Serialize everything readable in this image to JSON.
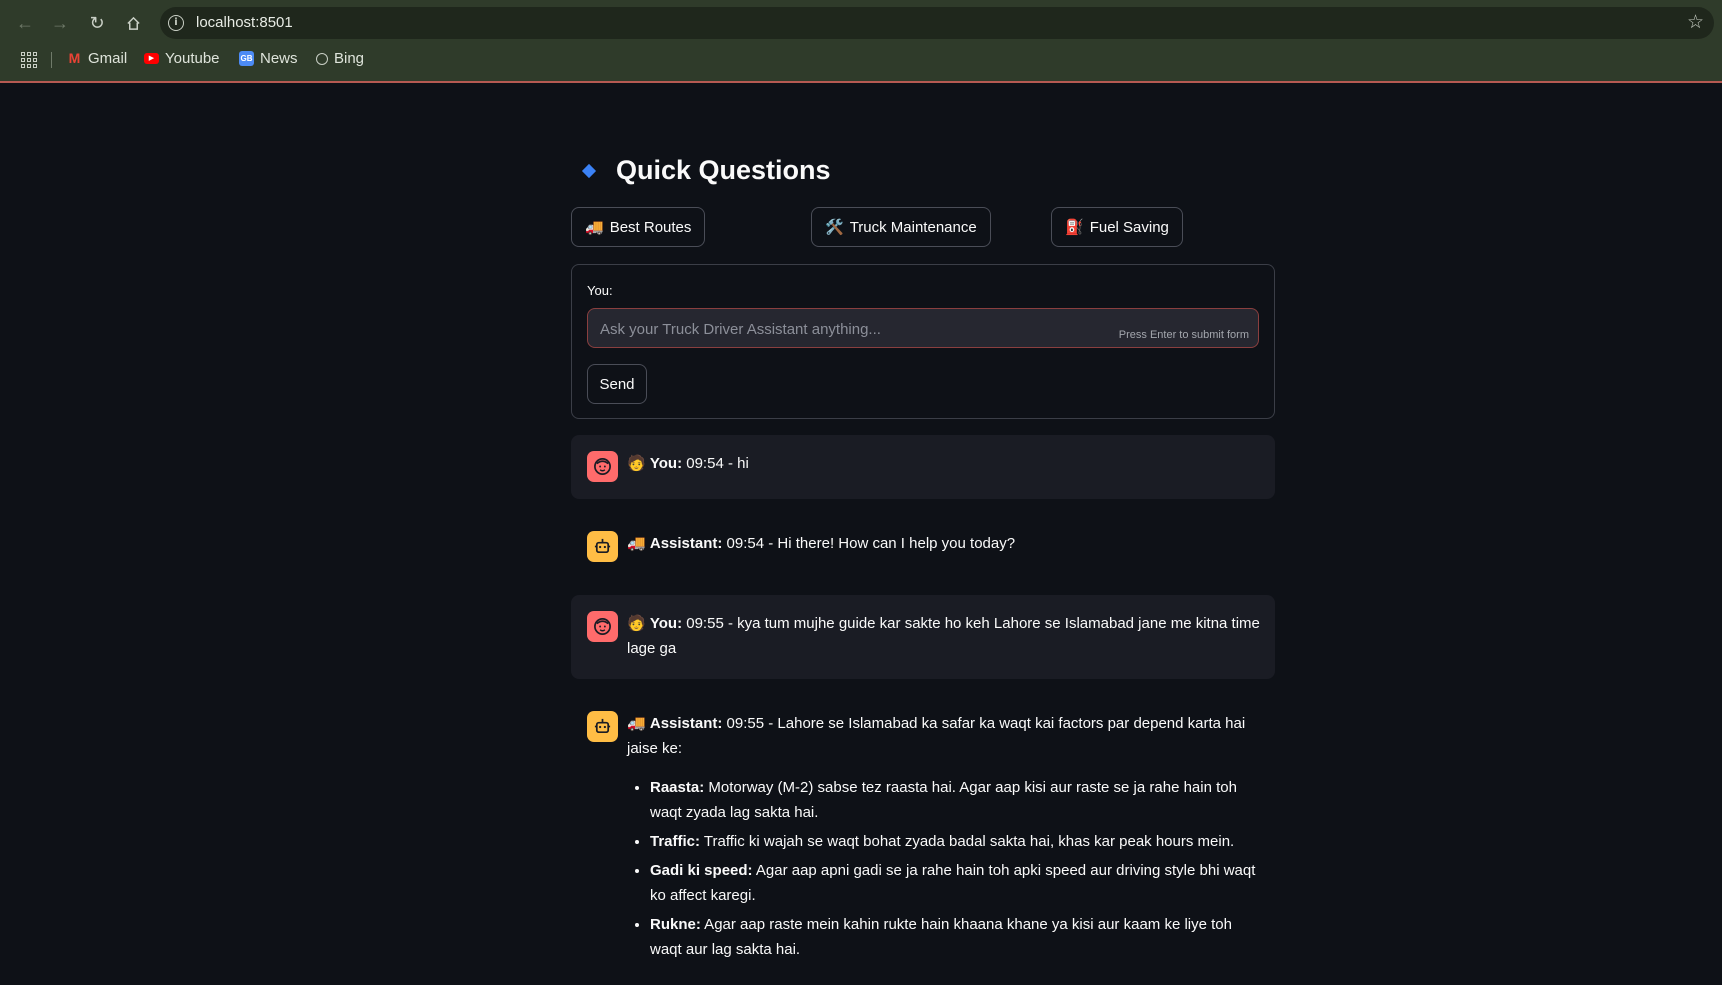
{
  "browser": {
    "url": "localhost:8501",
    "bookmarks": [
      {
        "label": "Gmail",
        "icon": "gmail-icon"
      },
      {
        "label": "Youtube",
        "icon": "youtube-icon"
      },
      {
        "label": "News",
        "icon": "news-icon"
      },
      {
        "label": "Bing",
        "icon": "globe-icon"
      }
    ]
  },
  "quick_questions": {
    "title": "Quick Questions",
    "buttons": [
      {
        "emoji": "🚚",
        "label": "Best Routes"
      },
      {
        "emoji": "🛠️",
        "label": "Truck Maintenance"
      },
      {
        "emoji": "⛽",
        "label": "Fuel Saving"
      }
    ]
  },
  "form": {
    "label": "You:",
    "placeholder": "Ask your Truck Driver Assistant anything...",
    "hint": "Press Enter to submit form",
    "send_label": "Send"
  },
  "messages": [
    {
      "role": "user",
      "emoji": "🧑",
      "speaker": "You:",
      "text": " 09:54 - hi"
    },
    {
      "role": "assistant",
      "emoji": "🚚",
      "speaker": "Assistant:",
      "text": " 09:54 - Hi there! How can I help you today?"
    },
    {
      "role": "user",
      "emoji": "🧑",
      "speaker": "You:",
      "text": " 09:55 - kya tum mujhe guide kar sakte ho keh Lahore se Islamabad jane me kitna time lage ga"
    },
    {
      "role": "assistant",
      "emoji": "🚚",
      "speaker": "Assistant:",
      "text": " 09:55 - Lahore se Islamabad ka safar ka waqt kai factors par depend karta hai jaise ke:",
      "bullets": [
        {
          "term": "Raasta:",
          "text": " Motorway (M-2) sabse tez raasta hai. Agar aap kisi aur raste se ja rahe hain toh waqt zyada lag sakta hai."
        },
        {
          "term": "Traffic:",
          "text": " Traffic ki wajah se waqt bohat zyada badal sakta hai, khas kar peak hours mein."
        },
        {
          "term": "Gadi ki speed:",
          "text": " Agar aap apni gadi se ja rahe hain toh apki speed aur driving style bhi waqt ko affect karegi."
        },
        {
          "term": "Rukne:",
          "text": " Agar aap raste mein kahin rukte hain khaana khane ya kisi aur kaam ke liye toh waqt aur lag sakta hai."
        }
      ]
    }
  ]
}
